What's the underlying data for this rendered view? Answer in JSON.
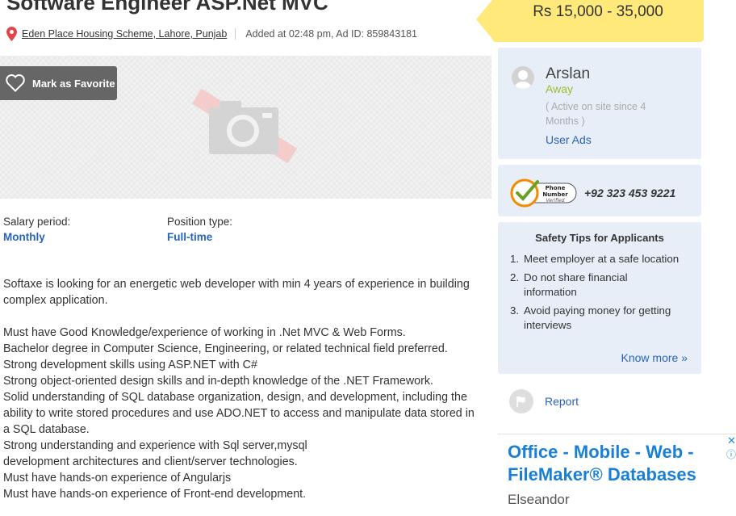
{
  "listing": {
    "title": "Software Engineer ASP.Net MVC",
    "location": "Eden Place Housing Scheme, Lahore, Punjab",
    "added": "Added at 02:48 pm, Ad ID: 859843181"
  },
  "photo": {
    "favorite_label": "Mark as Favorite",
    "placeholder_icon": "camera-icon"
  },
  "attributes": [
    {
      "label": "Salary period:",
      "value": "Monthly"
    },
    {
      "label": "Position type:",
      "value": "Full-time"
    }
  ],
  "description": {
    "intro": [
      "Softaxe is looking for an energetic web developer with min 4 years of experience in building complex application."
    ],
    "requirements": [
      "Must have Good Knowledge/experience of working in .Net MVC & Web Forms.",
      "Bachelor degree in Computer Science, Engineering, or related technical field preferred.",
      "Strong development skills using ASP.NET with C#",
      "Strong object-oriented design skills and in-depth knowledge of the .NET Framework.",
      "Solid understanding of SQL database organization, design, and development, including the ability to write stored procedures and use ADO.NET to access and manipulate data stored in a SQL database.",
      "Strong understanding and experience with Sql server,mysql",
      "development architectures and client/server technologies.",
      "Must have hands-on experience of Angularjs",
      "Must have hands-on experience of Front-end development."
    ]
  },
  "price": "Rs 15,000 - 35,000",
  "seller": {
    "name": "Arslan",
    "status": "Away",
    "since": "( Active on site since 4 Months )",
    "user_ads": "User Ads"
  },
  "phone": {
    "badge_line1": "Phone",
    "badge_line2": "Number",
    "badge_line3": "Verified",
    "number": "+92 323 453 9221"
  },
  "safety": {
    "title": "Safety Tips for Applicants",
    "tips": [
      {
        "num": "1.",
        "text": "Meet employer at a safe location"
      },
      {
        "num": "2.",
        "text": "Do not share financial information"
      },
      {
        "num": "3.",
        "text": "Avoid paying money for getting interviews"
      }
    ],
    "know_more": "Know more »"
  },
  "report": {
    "label": "Report"
  },
  "ad": {
    "title": "Office - Mobile - Web - FileMaker® Databases",
    "advertiser": "Elseandor",
    "close": "✕",
    "info": "ⓘ"
  },
  "colors": {
    "link": "#2a64b5",
    "price_bg": "#ffe97a",
    "card_bg": "#e7eef8",
    "status_away": "#9bbd33"
  }
}
